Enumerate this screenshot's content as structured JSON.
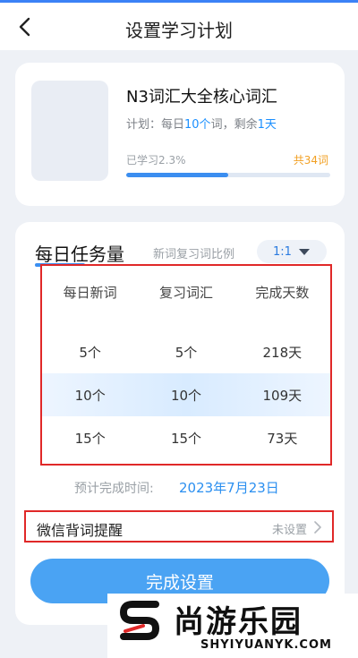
{
  "header": {
    "title": "设置学习计划",
    "back_icon": "chevron-left-icon"
  },
  "book": {
    "title": "N3词汇大全核心词汇",
    "plan_prefix": "计划：每日",
    "plan_daily_count": "10个",
    "plan_mid": "词，剩余",
    "plan_remaining": "1天",
    "progress_label": "已学习2.3%",
    "progress_fraction": 0.5,
    "total_words": "共34词"
  },
  "daily": {
    "title": "每日任务量",
    "ratio_label": "新词复习词比例",
    "ratio_value": "1:1",
    "headers": [
      "每日新词",
      "复习词汇",
      "完成天数"
    ],
    "rows": [
      [
        "5个",
        "5个",
        "218天"
      ],
      [
        "10个",
        "10个",
        "109天"
      ],
      [
        "15个",
        "15个",
        "73天"
      ]
    ],
    "selected_row": 1,
    "eta_label": "预计完成时间:",
    "eta_value": "2023年7月23日"
  },
  "reminder": {
    "label": "微信背词提醒",
    "status": "未设置"
  },
  "finish_button": "完成设置",
  "watermark": {
    "brand": "尚游乐园",
    "domain": "SHYIYUANYK.COM"
  },
  "colors": {
    "accent": "#3b8ef0",
    "highlight_text": "#1a8fff",
    "orange": "#f2a023",
    "annotation_red": "#e02828"
  }
}
